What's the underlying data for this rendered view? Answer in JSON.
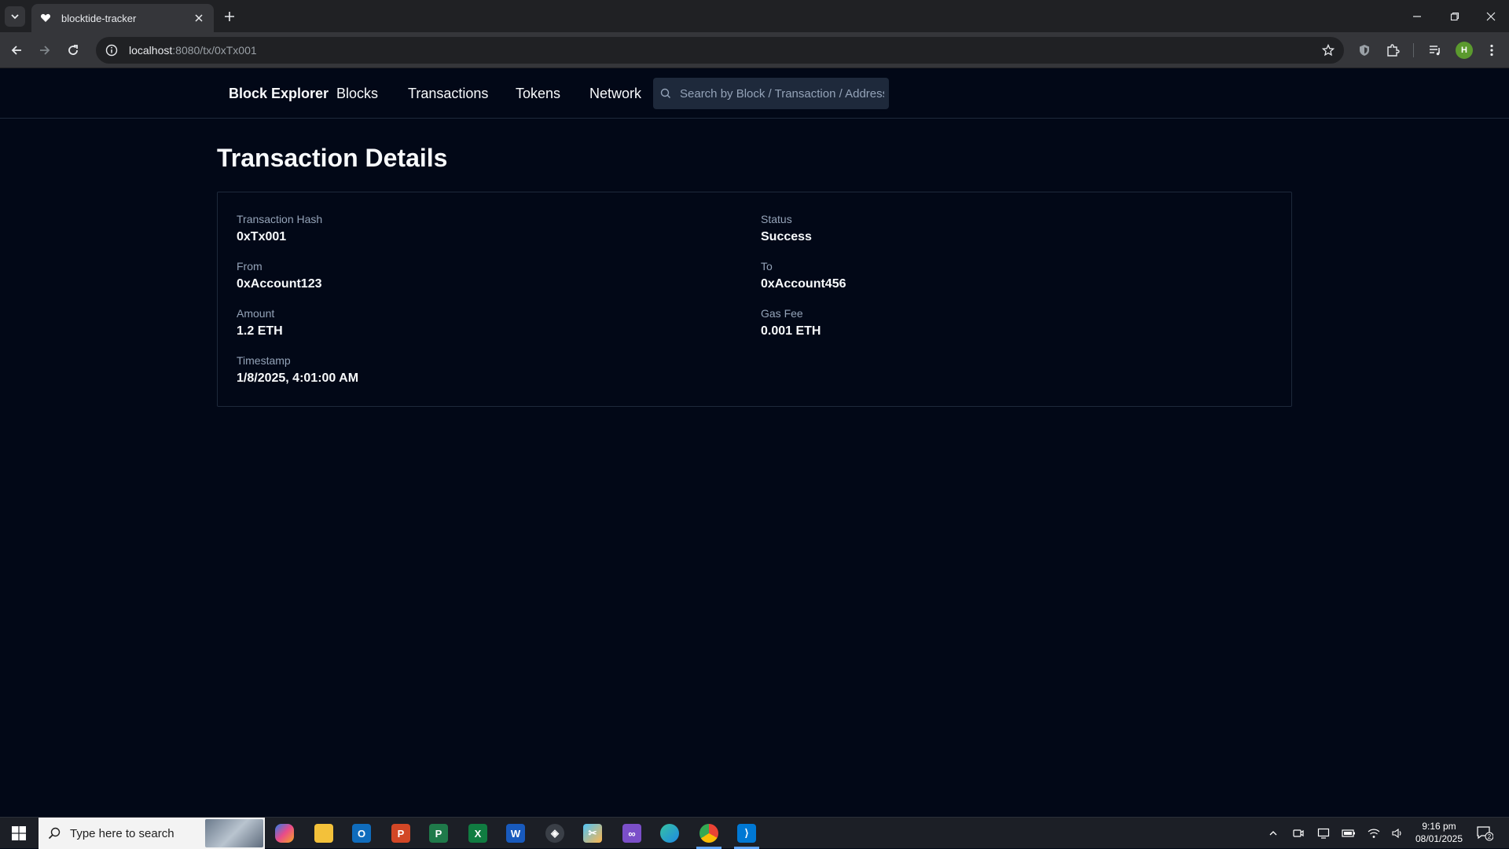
{
  "browser": {
    "tab_title": "blocktide-tracker",
    "url_host": "localhost",
    "url_path": ":8080/tx/0xTx001",
    "profile_initial": "H"
  },
  "navbar": {
    "brand": "Block Explorer",
    "links": [
      "Blocks",
      "Transactions",
      "Tokens",
      "Network"
    ],
    "search_placeholder": "Search by Block / Transaction / Address"
  },
  "page": {
    "title": "Transaction Details",
    "fields": {
      "hash": {
        "label": "Transaction Hash",
        "value": "0xTx001"
      },
      "status": {
        "label": "Status",
        "value": "Success"
      },
      "from": {
        "label": "From",
        "value": "0xAccount123"
      },
      "to": {
        "label": "To",
        "value": "0xAccount456"
      },
      "amount": {
        "label": "Amount",
        "value": "1.2 ETH"
      },
      "gas": {
        "label": "Gas Fee",
        "value": "0.001 ETH"
      },
      "timestamp": {
        "label": "Timestamp",
        "value": "1/8/2025, 4:01:00 AM"
      }
    }
  },
  "taskbar": {
    "search_placeholder": "Type here to search",
    "time": "9:16 pm",
    "date": "08/01/2025",
    "notification_count": "2"
  },
  "colors": {
    "background": "#020817",
    "border": "#1e293b",
    "text": "#f8fafc",
    "muted": "#94a3b8"
  }
}
